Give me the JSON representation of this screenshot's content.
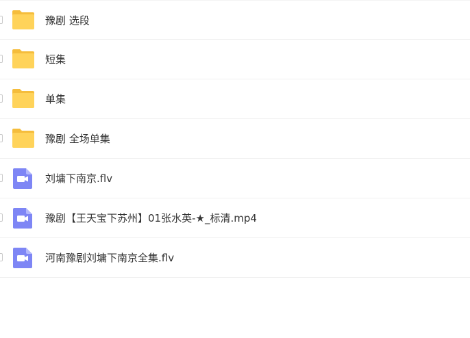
{
  "files": [
    {
      "name": "豫剧 选段",
      "type": "folder",
      "icon": "folder-icon"
    },
    {
      "name": "短集",
      "type": "folder",
      "icon": "folder-icon"
    },
    {
      "name": "单集",
      "type": "folder",
      "icon": "folder-icon"
    },
    {
      "name": "豫剧 全场单集",
      "type": "folder",
      "icon": "folder-icon"
    },
    {
      "name": "刘墉下南京.flv",
      "type": "video",
      "icon": "video-file-icon"
    },
    {
      "name": "豫剧【王天宝下苏州】01张水英-★_标清.mp4",
      "type": "video",
      "icon": "video-file-icon"
    },
    {
      "name": "河南豫剧刘墉下南京全集.flv",
      "type": "video",
      "icon": "video-file-icon"
    }
  ],
  "colors": {
    "folder": "#ffd35a",
    "folder_tab": "#f5bd3c",
    "video": "#7e86f5",
    "video_fold": "#b3b8fb",
    "divider": "#f0f0f0",
    "text": "#333333"
  }
}
